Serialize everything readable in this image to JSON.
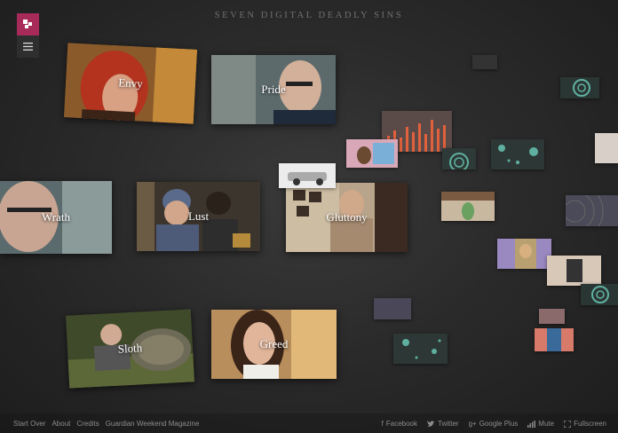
{
  "header": {
    "title": "SEVEN DIGITAL DEADLY SINS"
  },
  "sins": [
    {
      "label": "Envy"
    },
    {
      "label": "Pride"
    },
    {
      "label": "Wrath"
    },
    {
      "label": "Lust"
    },
    {
      "label": "Gluttony"
    },
    {
      "label": "Sloth"
    },
    {
      "label": "Greed"
    }
  ],
  "footer": {
    "left_links": [
      "Start Over",
      "About",
      "Credits",
      "Guardian Weekend Magazine"
    ],
    "right_links": [
      {
        "label": "Facebook",
        "icon": "facebook-icon"
      },
      {
        "label": "Twitter",
        "icon": "twitter-icon"
      },
      {
        "label": "Google Plus",
        "icon": "google-plus-icon"
      },
      {
        "label": "Mute",
        "icon": "volume-icon"
      },
      {
        "label": "Fullscreen",
        "icon": "fullscreen-icon"
      }
    ]
  },
  "colors": {
    "accent": "#a72a58",
    "background": "#2b2b2b"
  }
}
